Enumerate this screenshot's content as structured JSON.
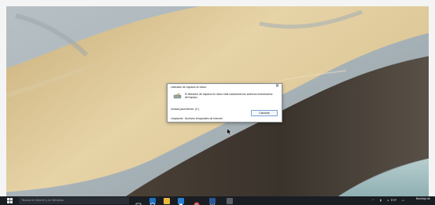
{
  "dialog": {
    "title": "Liberador de espacio en disco",
    "message": "El liberador de espacio en disco está calculando los archivos innecesarios del equipo.",
    "drive_label": "Unidad para liberar: (C:)",
    "cancel_label": "Cancelar",
    "status_left": "Limpiando",
    "status_right": "Archivos temporales de Internet",
    "close_symbol": "✕"
  },
  "taskbar": {
    "search_placeholder": "Buscar en Internet y en Windows",
    "pinned_icons": [
      "task-view-icon",
      "edge-icon",
      "file-explorer-icon",
      "store-icon",
      "chrome-icon",
      "word-icon",
      "photos-icon"
    ],
    "tray_lang": "ESP",
    "clock_line1": "Bandeja de",
    "accent": "#1e90ff"
  }
}
